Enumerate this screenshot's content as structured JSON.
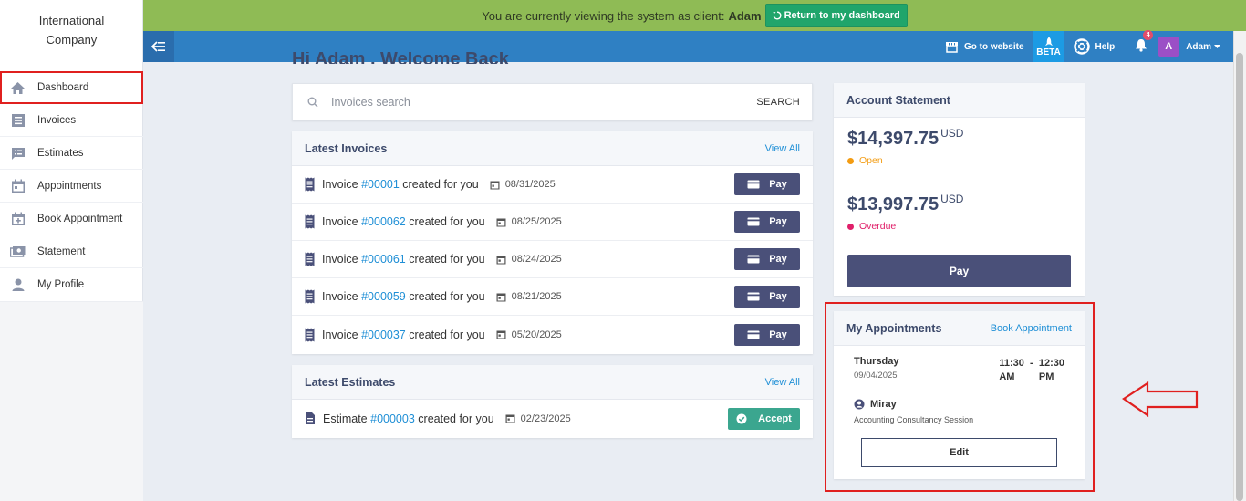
{
  "sidebar": {
    "brand": "International Company",
    "items": [
      {
        "label": "Dashboard",
        "icon": "home-icon",
        "active": true
      },
      {
        "label": "Invoices",
        "icon": "invoice-icon"
      },
      {
        "label": "Estimates",
        "icon": "estimate-icon"
      },
      {
        "label": "Appointments",
        "icon": "calendar-icon"
      },
      {
        "label": "Book Appointment",
        "icon": "calendar-plus-icon"
      },
      {
        "label": "Statement",
        "icon": "money-icon"
      },
      {
        "label": "My Profile",
        "icon": "user-icon"
      }
    ]
  },
  "banner": {
    "text": "You are currently viewing the system as client:",
    "client": "Adam",
    "return_label": "Return to my dashboard"
  },
  "navbar": {
    "website": "Go to website",
    "beta": "BETA",
    "help": "Help",
    "notifications": "4",
    "avatar_letter": "A",
    "user": "Adam"
  },
  "welcome": "Hi Adam , Welcome Back",
  "search": {
    "placeholder": "Invoices search",
    "button": "SEARCH"
  },
  "invoices": {
    "title": "Latest Invoices",
    "view_all": "View All",
    "pay_label": "Pay",
    "prefix": "Invoice",
    "suffix": "created for you",
    "rows": [
      {
        "number": "#00001",
        "date": "08/31/2025"
      },
      {
        "number": "#000062",
        "date": "08/25/2025"
      },
      {
        "number": "#000061",
        "date": "08/24/2025"
      },
      {
        "number": "#000059",
        "date": "08/21/2025"
      },
      {
        "number": "#000037",
        "date": "05/20/2025"
      }
    ]
  },
  "estimates": {
    "title": "Latest Estimates",
    "view_all": "View All",
    "prefix": "Estimate",
    "number": "#000003",
    "suffix": "created for you",
    "date": "02/23/2025",
    "accept_label": "Accept"
  },
  "account": {
    "title": "Account Statement",
    "open_amount": "$14,397.75",
    "open_currency": "USD",
    "open_label": "Open",
    "overdue_amount": "$13,997.75",
    "overdue_currency": "USD",
    "overdue_label": "Overdue",
    "pay_label": "Pay",
    "colors": {
      "open": "#f39c12",
      "overdue": "#e0206a"
    }
  },
  "appointments": {
    "title": "My Appointments",
    "book_label": "Book Appointment",
    "day": "Thursday",
    "date": "09/04/2025",
    "start_h": "11:30",
    "start_p": "AM",
    "end_h": "12:30",
    "end_p": "PM",
    "dash": "-",
    "person": "Miray",
    "service": "Accounting Consultancy Session",
    "edit_label": "Edit"
  }
}
